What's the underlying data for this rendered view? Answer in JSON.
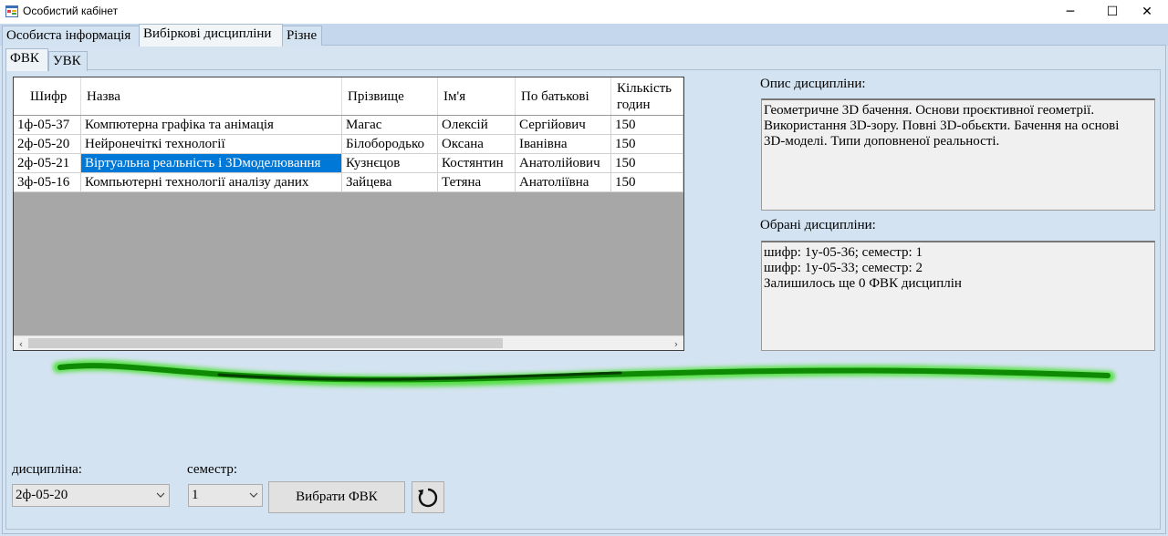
{
  "window": {
    "title": "Особистий кабінет",
    "minimize": "─",
    "maximize": "☐",
    "close": "✕"
  },
  "main_tabs": [
    "Особиста інформація",
    "Вибіркові дисципліни",
    "Різне"
  ],
  "sub_tabs": [
    "ФВК",
    "УВК"
  ],
  "grid": {
    "columns": [
      "Шифр",
      "Назва",
      "Прізвище",
      "Ім'я",
      "По батькові",
      "Кількість годин"
    ],
    "rows": [
      [
        "1ф-05-37",
        "Компютерна графіка та анімація",
        "Магас",
        "Олексій",
        "Сергійович",
        "150"
      ],
      [
        "2ф-05-20",
        "Нейронечіткі технології",
        "Білобородько",
        "Оксана",
        "Іванівна",
        "150"
      ],
      [
        "2ф-05-21",
        "Віртуальна реальність і 3Dмоделювання",
        "Кузнєцов",
        "Костянтин",
        "Анатолійович",
        "150"
      ],
      [
        "3ф-05-16",
        "Компьютерні технології аналізу даних",
        "Зайцева",
        "Тетяна",
        "Анатоліївна",
        "150"
      ]
    ],
    "selected_row": 2,
    "scroll_left": "‹",
    "scroll_right": "›"
  },
  "description": {
    "label": "Опис дисципліни:",
    "lines": [
      "Геометричне 3D бачення. Основи проєктивної геометрії.",
      "Використання 3D-зору. Повні 3D-обьєкти. Бачення на основі",
      "3D-моделі. Типи доповненої реальності."
    ]
  },
  "chosen": {
    "label": "Обрані дисципліни:",
    "lines": [
      "шифр: 1у-05-36; семестр: 1",
      "шифр: 1у-05-33; семестр: 2",
      "Залишилось ще 0 ФВК дисциплін"
    ]
  },
  "form": {
    "discipline_label": "дисципліна:",
    "discipline_value": "2ф-05-20",
    "semester_label": "семестр:",
    "semester_value": "1",
    "choose_button": "Вибрати ФВК",
    "refresh_icon": "refresh-icon"
  },
  "colors": {
    "selection": "#0078d7",
    "highlight_stroke": "#1fd20a"
  }
}
